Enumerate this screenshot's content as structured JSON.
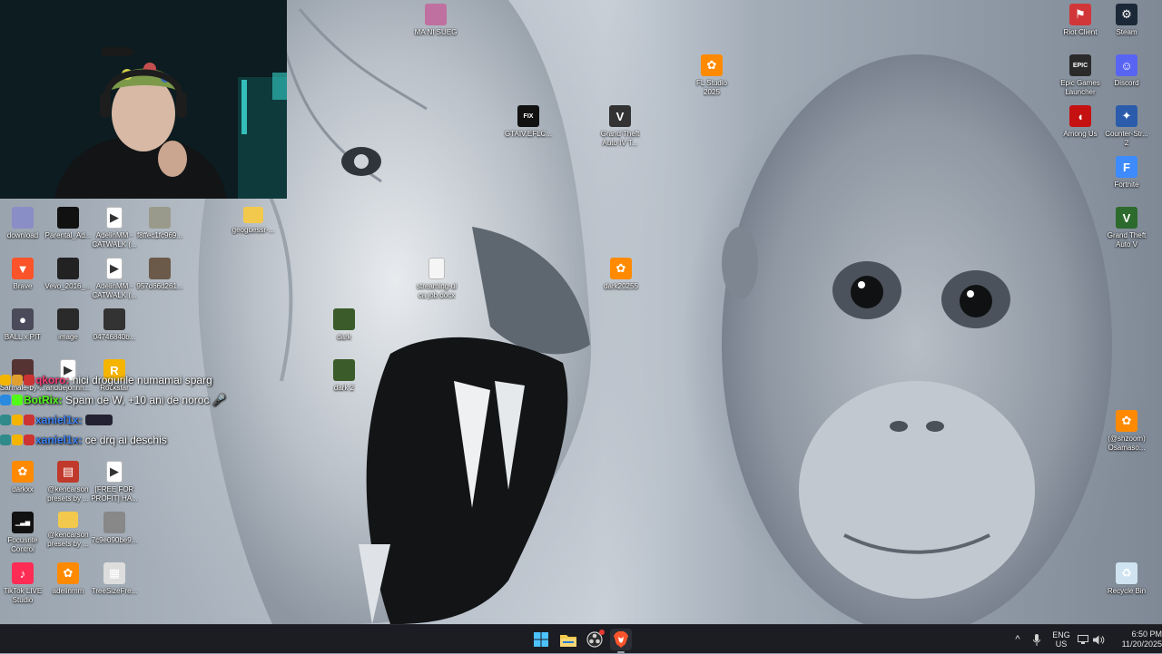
{
  "webcam": {
    "label": "streamer-webcam"
  },
  "desktop": {
    "icons": [
      {
        "id": "download",
        "label": "download",
        "icon": "image-icon",
        "color": "#8a8ec6"
      },
      {
        "id": "parental",
        "label": "Parental_Ad...",
        "icon": "image-icon",
        "color": "#111111"
      },
      {
        "id": "adelin-catwalk-1",
        "label": "AdelinMM -\nCATWALK (...",
        "icon": "video-file-icon",
        "color": "#ffffff"
      },
      {
        "id": "f8ffec",
        "label": "f8ffec1fc969...",
        "icon": "image-icon",
        "color": "#9a9a8c"
      },
      {
        "id": "geoguessr",
        "label": "geoguessr-...",
        "icon": "folder-icon",
        "color": "#f2c94c"
      },
      {
        "id": "brave",
        "label": "Brave",
        "icon": "brave-icon",
        "color": "#fb542b"
      },
      {
        "id": "vevo",
        "label": "Vevo_2016_...",
        "icon": "image-icon",
        "color": "#222222"
      },
      {
        "id": "adelin-catwalk-2",
        "label": "AdelinMM -\nCATWALK (...",
        "icon": "video-file-icon",
        "color": "#ffffff"
      },
      {
        "id": "957d",
        "label": "957d66d261...",
        "icon": "image-icon",
        "color": "#6b5a4a"
      },
      {
        "id": "ball-pit",
        "label": "BALL x PIT",
        "icon": "game-icon",
        "color": "#4a4a5a"
      },
      {
        "id": "image",
        "label": "image",
        "icon": "image-icon",
        "color": "#2a2a2a"
      },
      {
        "id": "04746",
        "label": "04746840b...",
        "icon": "image-icon",
        "color": "#333333"
      },
      {
        "id": "dark",
        "label": "dark",
        "icon": "image-icon",
        "color": "#3b5b2a"
      },
      {
        "id": "dark2",
        "label": "dark 2",
        "icon": "image-icon",
        "color": "#3b5b2a"
      },
      {
        "id": "streaming",
        "label": "streaming-ul\nca job.docx",
        "icon": "document-icon",
        "color": "#f5f5f5"
      },
      {
        "id": "gtaiv-eflc",
        "label": "GTAIV.EFLC...",
        "icon": "fusionfix-icon",
        "color": "#111111"
      },
      {
        "id": "gta4",
        "label": "Grand Theft\nAuto IV T...",
        "icon": "gta-icon",
        "color": "#333333"
      },
      {
        "id": "mani",
        "label": "MA NI SUEG",
        "icon": "image-icon",
        "color": "#c070a0"
      },
      {
        "id": "flstudio",
        "label": "FL Studio\n2025",
        "icon": "flstudio-icon",
        "color": "#ff8a00"
      },
      {
        "id": "dark20255",
        "label": "dark20255",
        "icon": "flstudio-icon",
        "color": "#ff8a00"
      },
      {
        "id": "sarmale",
        "label": "Sarmale-by-...",
        "icon": "image-icon",
        "color": "#553333"
      },
      {
        "id": "anduejonnn",
        "label": "anduejonnn...",
        "icon": "video-file-icon",
        "color": "#ffffff"
      },
      {
        "id": "rockstar",
        "label": "Rockstar",
        "icon": "rockstar-icon",
        "color": "#f4b400"
      },
      {
        "id": "darkxx",
        "label": "darkxx",
        "icon": "flstudio-icon",
        "color": "#ff8a00"
      },
      {
        "id": "kencarson-1",
        "label": "@kencarson\npresets by ...",
        "icon": "archive-icon",
        "color": "#c0392b"
      },
      {
        "id": "free-for-profit",
        "label": "[FREE FOR\nPROFIT] HA...",
        "icon": "video-file-icon",
        "color": "#ffffff"
      },
      {
        "id": "focusrite",
        "label": "Focusrite\nControl",
        "icon": "focusrite-icon",
        "color": "#111111"
      },
      {
        "id": "kencarson-2",
        "label": "@kencarson\npresets by ...",
        "icon": "folder-icon",
        "color": "#f2c94c"
      },
      {
        "id": "7c9e",
        "label": "7c9e090be9...",
        "icon": "image-icon",
        "color": "#888888"
      },
      {
        "id": "tiktok",
        "label": "TikTok LIVE\nStudio",
        "icon": "tiktok-icon",
        "color": "#fe2c55"
      },
      {
        "id": "adelinmm",
        "label": "adelinmm",
        "icon": "flstudio-icon",
        "color": "#ff8a00"
      },
      {
        "id": "treesize",
        "label": "TreeSizeFre...",
        "icon": "treesize-icon",
        "color": "#dddddd"
      },
      {
        "id": "riot",
        "label": "Riot Client",
        "icon": "riot-icon",
        "color": "#d13639"
      },
      {
        "id": "steam",
        "label": "Steam",
        "icon": "steam-icon",
        "color": "#1b2838"
      },
      {
        "id": "epic",
        "label": "Epic Games\nLauncher",
        "icon": "epic-icon",
        "color": "#2a2a2a"
      },
      {
        "id": "discord",
        "label": "Discord",
        "icon": "discord-icon",
        "color": "#5865f2"
      },
      {
        "id": "among-us",
        "label": "Among Us",
        "icon": "amongus-icon",
        "color": "#c51111"
      },
      {
        "id": "cs2",
        "label": "Counter-Str...\n2",
        "icon": "cs2-icon",
        "color": "#2b5cab"
      },
      {
        "id": "fortnite",
        "label": "Fortnite",
        "icon": "fortnite-icon",
        "color": "#3d8bfd"
      },
      {
        "id": "gta5",
        "label": "Grand Theft\nAuto V",
        "icon": "gta-icon",
        "color": "#2d6a2d"
      },
      {
        "id": "shzoom",
        "label": "(@shzoom)\nOsamaso...",
        "icon": "flstudio-icon",
        "color": "#ff8a00"
      },
      {
        "id": "recycle",
        "label": "Recycle Bin",
        "icon": "recycle-bin-icon",
        "color": "#cfe3f0"
      }
    ]
  },
  "chat": {
    "messages": [
      {
        "user": "qkoro:",
        "user_color": "#ff3c78",
        "text": "nici drogurile numamai sparg"
      },
      {
        "user": "BotRix:",
        "user_color": "#53fc18",
        "text": "Spam de W, +10 ani de noroc 🎤"
      },
      {
        "user": "xaniel1x:",
        "user_color": "#3b82f6",
        "text": ""
      },
      {
        "user": "xaniel1x:",
        "user_color": "#3b82f6",
        "text": "ce drq ai deschis"
      }
    ]
  },
  "taskbar": {
    "apps": [
      {
        "id": "start",
        "icon": "windows-start-icon"
      },
      {
        "id": "explorer",
        "icon": "file-explorer-icon"
      },
      {
        "id": "obs",
        "icon": "obs-icon"
      },
      {
        "id": "brave",
        "icon": "brave-icon"
      }
    ],
    "tray": {
      "chevron": "^",
      "lang_top": "ENG",
      "lang_bottom": "US",
      "time": "6:50 PM",
      "date": "11/20/2025"
    }
  },
  "colors": {
    "taskbar_bg": "#1b1d22",
    "accent": "#3b82f6"
  }
}
